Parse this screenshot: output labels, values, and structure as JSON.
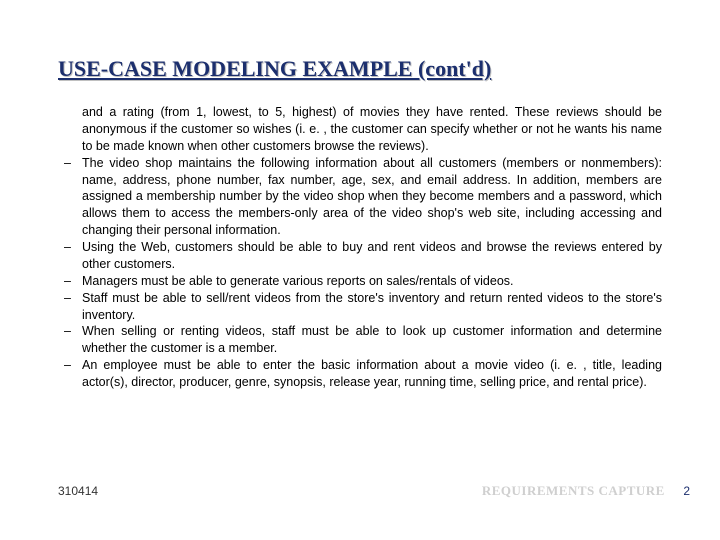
{
  "title": "USE-CASE MODELING EXAMPLE (cont'd)",
  "intro": "and a rating (from 1, lowest, to 5, highest) of movies they have rented. These reviews should be anonymous if the customer so wishes (i. e. , the customer can specify whether or not he wants his name to be made known when other customers browse the reviews).",
  "bullets": [
    "The video shop maintains the following information about all customers (members or nonmembers): name, address, phone number, fax number, age, sex, and email address. In addition, members are assigned a membership number by the video shop when they become members and a password, which allows them to access the members-only area of the video shop's web site, including accessing and changing their personal information.",
    "Using the Web, customers should be able to buy and rent videos and browse the reviews entered by other customers.",
    "Managers must be able to generate various reports on sales/rentals of videos.",
    "Staff must be able to sell/rent videos from the store's inventory and return rented videos to the store's inventory.",
    "When selling or renting videos, staff must be able to look up customer information and determine whether the customer is a member.",
    "An employee must be able to enter the basic information about a movie video (i. e. , title, leading actor(s), director, producer, genre, synopsis, release year, running time, selling price, and rental price)."
  ],
  "footer": {
    "date": "310414",
    "label": "REQUIREMENTS CAPTURE",
    "page": "2"
  }
}
